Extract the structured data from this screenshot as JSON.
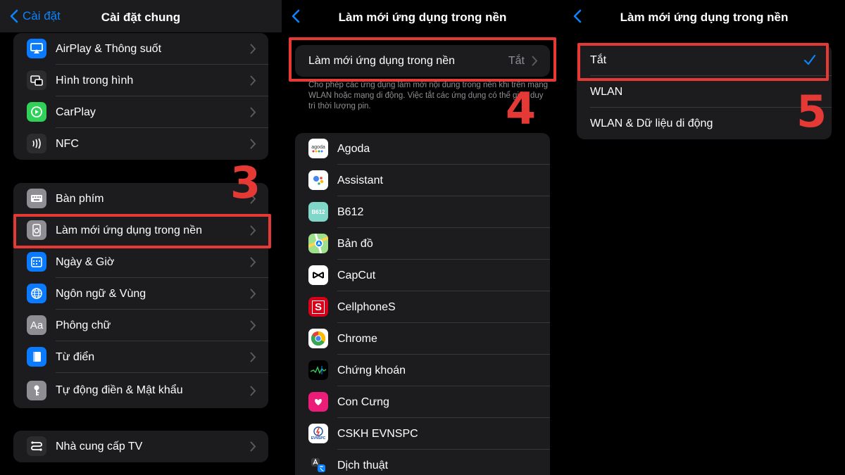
{
  "panel1": {
    "back_label": "Cài đặt",
    "title": "Cài đặt chung",
    "group1": [
      {
        "label": "AirPlay & Thông suốt",
        "icon": "airplay-icon"
      },
      {
        "label": "Hình trong hình",
        "icon": "picture-in-picture-icon"
      },
      {
        "label": "CarPlay",
        "icon": "carplay-icon"
      },
      {
        "label": "NFC",
        "icon": "nfc-icon"
      }
    ],
    "group2": [
      {
        "label": "Bàn phím",
        "icon": "keyboard-icon"
      },
      {
        "label": "Làm mới ứng dụng trong nền",
        "icon": "background-refresh-icon"
      },
      {
        "label": "Ngày & Giờ",
        "icon": "calendar-icon"
      },
      {
        "label": "Ngôn ngữ & Vùng",
        "icon": "globe-icon"
      },
      {
        "label": "Phông chữ",
        "icon": "font-icon",
        "glyph": "Aa"
      },
      {
        "label": "Từ điển",
        "icon": "dictionary-icon"
      },
      {
        "label": "Tự động điền & Mật khẩu",
        "icon": "key-icon"
      }
    ],
    "group3": [
      {
        "label": "Nhà cung cấp TV",
        "icon": "tv-provider-icon"
      }
    ],
    "step": "3"
  },
  "panel2": {
    "title": "Làm mới ứng dụng trong nền",
    "setting": {
      "label": "Làm mới ứng dụng trong nền",
      "value": "Tắt"
    },
    "footer": "Cho phép các ứng dụng làm mới nội dung trong nền khi trên mạng WLAN hoặc mạng di động. Việc tắt các ứng dụng có thể giúp duy trì thời lượng pin.",
    "step": "4",
    "apps": [
      {
        "label": "Agoda",
        "icon": "agoda-icon",
        "glyph": "agoda"
      },
      {
        "label": "Assistant",
        "icon": "google-assistant-icon"
      },
      {
        "label": "B612",
        "icon": "b612-icon",
        "glyph": "B612"
      },
      {
        "label": "Bản đồ",
        "icon": "maps-icon"
      },
      {
        "label": "CapCut",
        "icon": "capcut-icon"
      },
      {
        "label": "CellphoneS",
        "icon": "cellphones-icon",
        "glyph": "S"
      },
      {
        "label": "Chrome",
        "icon": "chrome-icon"
      },
      {
        "label": "Chứng khoán",
        "icon": "stocks-icon"
      },
      {
        "label": "Con Cưng",
        "icon": "con-cung-icon"
      },
      {
        "label": "CSKH EVNSPC",
        "icon": "evnspc-icon",
        "glyph": "EVNSPC"
      },
      {
        "label": "Dịch thuật",
        "icon": "translate-icon"
      }
    ]
  },
  "panel3": {
    "title": "Làm mới ứng dụng trong nền",
    "options": [
      {
        "label": "Tắt",
        "selected": true
      },
      {
        "label": "WLAN",
        "selected": false
      },
      {
        "label": "WLAN & Dữ liệu di động",
        "selected": false
      }
    ],
    "step": "5"
  },
  "colors": {
    "accent": "#0a84ff",
    "highlight": "#e53935",
    "group_bg": "#1c1c1e",
    "secondary_text": "#8e8e93"
  }
}
